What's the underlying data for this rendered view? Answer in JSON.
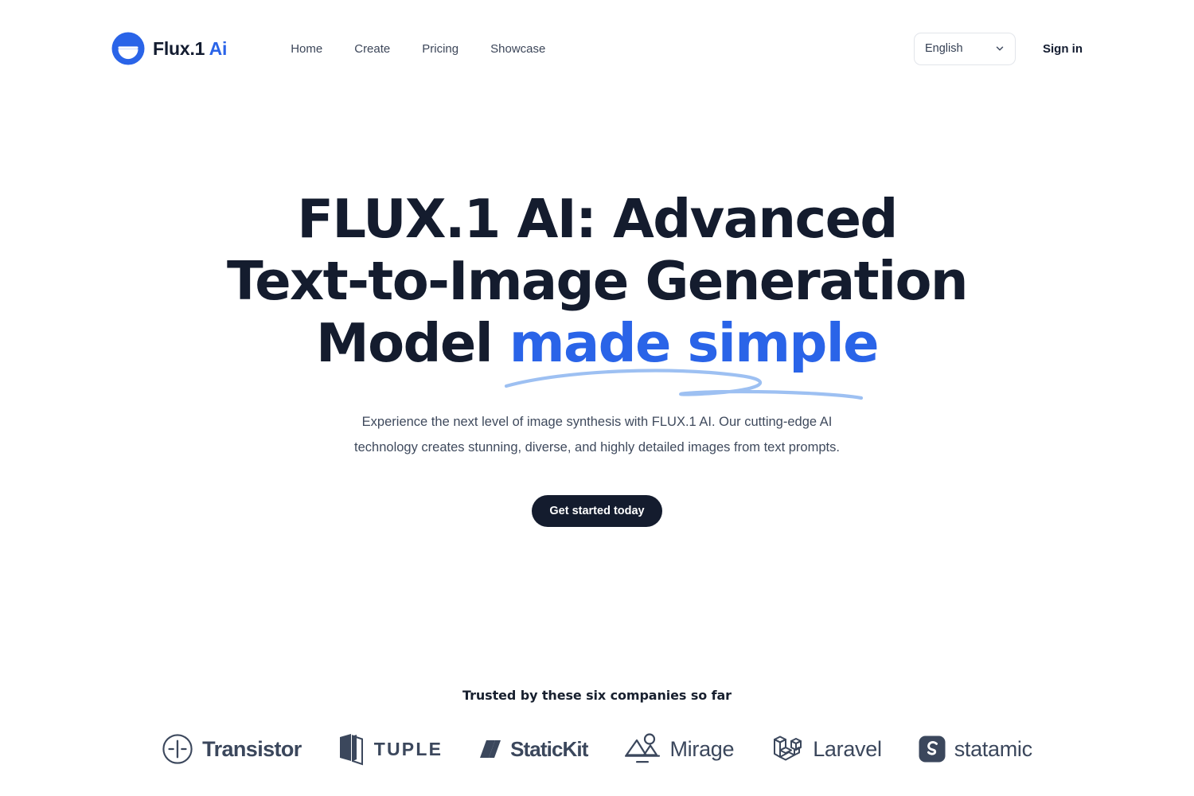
{
  "header": {
    "brand": {
      "logo_icon": "flux-circle-icon",
      "name": "Flux.1",
      "accent": "Ai"
    },
    "nav": [
      {
        "label": "Home"
      },
      {
        "label": "Create"
      },
      {
        "label": "Pricing"
      },
      {
        "label": "Showcase"
      }
    ],
    "language_select": {
      "value": "English",
      "icon": "chevron-down-icon"
    },
    "sign_in_label": "Sign in"
  },
  "hero": {
    "heading_line1": "FLUX.1 AI: Advanced",
    "heading_line2": "Text-to-Image Generation",
    "heading_line3_prefix": "Model ",
    "heading_highlight": "made simple",
    "subtitle": "Experience the next level of image synthesis with FLUX.1 AI. Our cutting-edge AI technology creates stunning, diverse, and highly detailed images from text prompts.",
    "cta_label": "Get started today"
  },
  "trusted": {
    "title": "Trusted by these six companies so far",
    "companies": [
      {
        "name": "Transistor",
        "icon": "transistor-icon"
      },
      {
        "name": "TUPLE",
        "icon": "tuple-icon"
      },
      {
        "name": "StaticKit",
        "icon": "statickit-icon"
      },
      {
        "name": "Mirage",
        "icon": "mirage-icon"
      },
      {
        "name": "Laravel",
        "icon": "laravel-icon"
      },
      {
        "name": "statamic",
        "icon": "statamic-icon"
      }
    ]
  },
  "colors": {
    "accent_blue": "#2a64e8",
    "swoosh_blue": "#9dc0f2",
    "ink": "#141c2e",
    "muted": "#3f4a5d",
    "logo_gray": "#3b475c",
    "background": "#ffffff"
  }
}
